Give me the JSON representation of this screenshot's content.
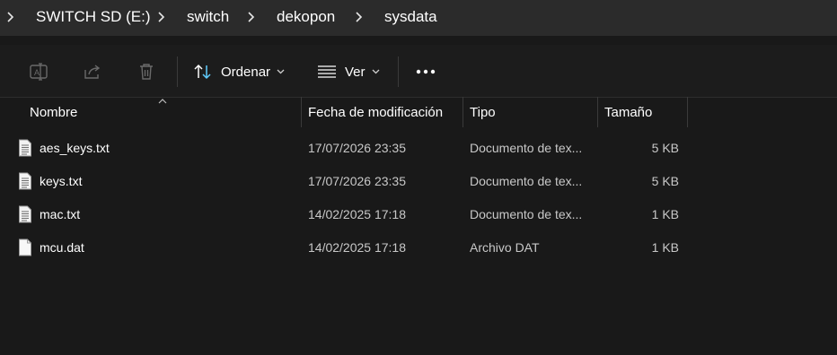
{
  "breadcrumb": {
    "items": [
      "SWITCH SD (E:)",
      "switch",
      "dekopon",
      "sysdata"
    ],
    "separator_icon": "chevron-right-icon"
  },
  "toolbar": {
    "rename_icon": "rename-icon",
    "share_icon": "share-icon",
    "delete_icon": "trash-icon",
    "sort_label": "Ordenar",
    "sort_icon": "sort-arrows-icon",
    "view_label": "Ver",
    "view_icon": "view-lines-icon",
    "more_icon": "more-options-icon"
  },
  "columns": {
    "name": "Nombre",
    "date": "Fecha de modificación",
    "type": "Tipo",
    "size": "Tamaño"
  },
  "files": [
    {
      "name": "aes_keys.txt",
      "date": "17/07/2026 23:35",
      "type": "Documento de tex...",
      "size": "5 KB",
      "icon": "text-file-icon"
    },
    {
      "name": "keys.txt",
      "date": "17/07/2026 23:35",
      "type": "Documento de tex...",
      "size": "5 KB",
      "icon": "text-file-icon"
    },
    {
      "name": "mac.txt",
      "date": "14/02/2025 17:18",
      "type": "Documento de tex...",
      "size": "1 KB",
      "icon": "text-file-icon"
    },
    {
      "name": "mcu.dat",
      "date": "14/02/2025 17:18",
      "type": "Archivo DAT",
      "size": "1 KB",
      "icon": "blank-file-icon"
    }
  ],
  "colors": {
    "background": "#191919",
    "breadcrumb_bar": "#2b2b2b",
    "text": "#ffffff",
    "secondary_text": "#c8c8c8",
    "sort_icon_accent": "#60cdff"
  }
}
